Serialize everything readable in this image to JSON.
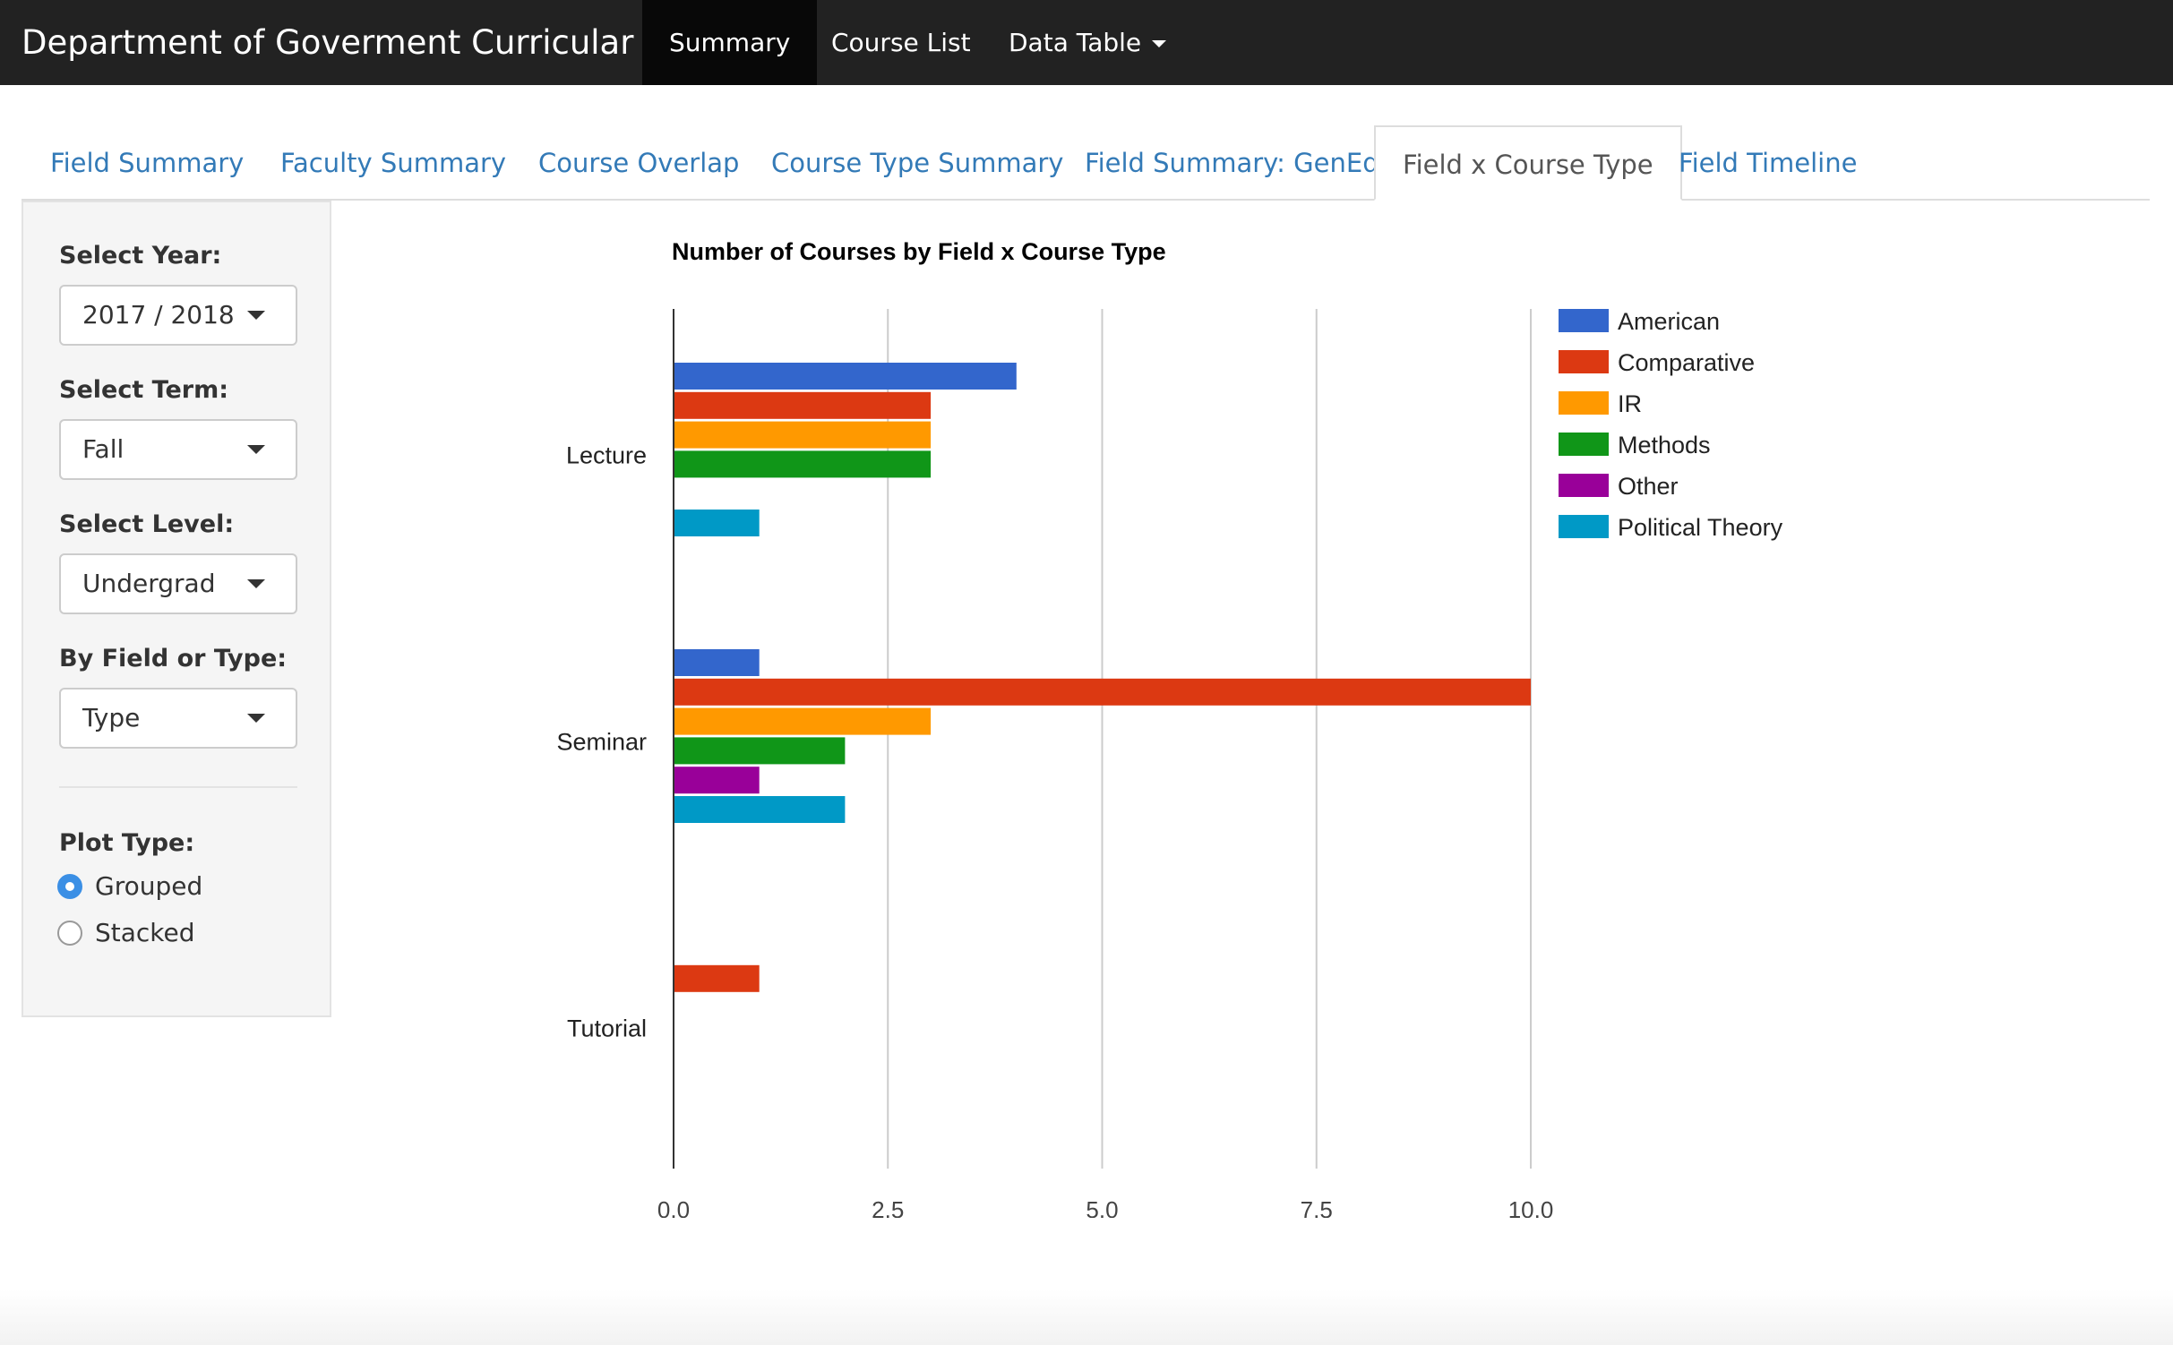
{
  "navbar": {
    "brand": "Department of Goverment Curricular Plan",
    "links": [
      {
        "label": "Summary",
        "active": true
      },
      {
        "label": "Course List",
        "active": false
      },
      {
        "label": "Data Table",
        "active": false
      }
    ]
  },
  "tabs": [
    {
      "label": "Field Summary"
    },
    {
      "label": "Faculty Summary"
    },
    {
      "label": "Course Overlap"
    },
    {
      "label": "Course Type Summary"
    },
    {
      "label": "Field Summary: GenEd"
    },
    {
      "label": "Field x Course Type",
      "active": true
    },
    {
      "label": "Field Timeline"
    }
  ],
  "sidebar": {
    "year": {
      "label": "Select Year:",
      "value": "2017 / 2018"
    },
    "term": {
      "label": "Select Term:",
      "value": "Fall"
    },
    "level": {
      "label": "Select Level:",
      "value": "Undergrad"
    },
    "by": {
      "label": "By Field or Type:",
      "value": "Type"
    },
    "plot_type": {
      "label": "Plot Type:",
      "options": [
        {
          "label": "Grouped",
          "checked": true
        },
        {
          "label": "Stacked",
          "checked": false
        }
      ]
    }
  },
  "chart_data": {
    "type": "bar",
    "orientation": "horizontal",
    "title": "Number of Courses by Field x Course Type",
    "categories": [
      "Lecture",
      "Seminar",
      "Tutorial"
    ],
    "series": [
      {
        "name": "American",
        "color": "#3366cc",
        "values": [
          4,
          1,
          0
        ]
      },
      {
        "name": "Comparative",
        "color": "#dc3912",
        "values": [
          3,
          10,
          1
        ]
      },
      {
        "name": "IR",
        "color": "#ff9900",
        "values": [
          3,
          3,
          0
        ]
      },
      {
        "name": "Methods",
        "color": "#109618",
        "values": [
          3,
          2,
          0
        ]
      },
      {
        "name": "Other",
        "color": "#990099",
        "values": [
          0,
          1,
          0
        ]
      },
      {
        "name": "Political Theory",
        "color": "#0099c6",
        "values": [
          1,
          2,
          0
        ]
      }
    ],
    "xlim": [
      0,
      10
    ],
    "xticks": [
      "0.0",
      "2.5",
      "5.0",
      "7.5",
      "10.0"
    ],
    "xtick_values": [
      0,
      2.5,
      5,
      7.5,
      10
    ],
    "grid": true,
    "legend_position": "right"
  }
}
